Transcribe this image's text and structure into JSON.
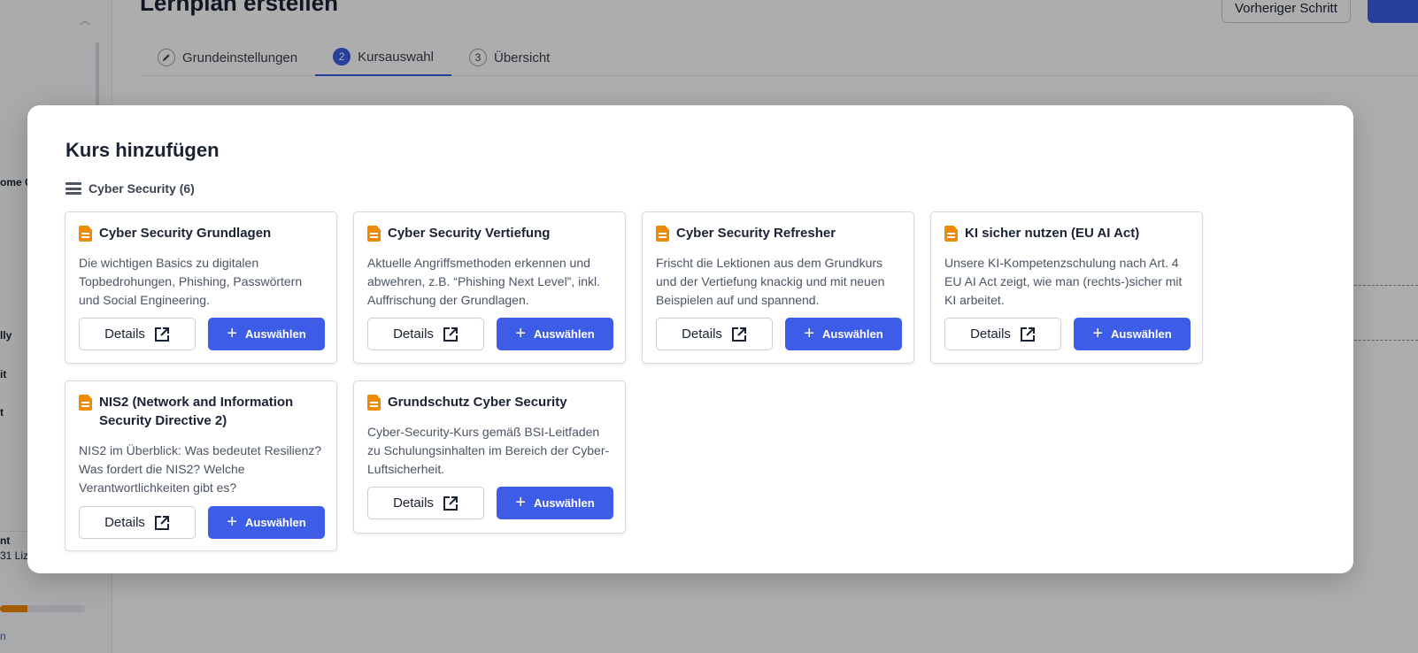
{
  "page": {
    "title": "Lernplan erstellen",
    "prev_button": "Vorheriger Schritt",
    "steps": [
      {
        "num": "",
        "label": "Grundeinstellungen"
      },
      {
        "num": "2",
        "label": "Kursauswahl"
      },
      {
        "num": "3",
        "label": "Übersicht"
      }
    ]
  },
  "sidebar": {
    "fragments": [
      "ome C",
      "lly",
      "it",
      "t"
    ],
    "footer_label": "nt",
    "footer_sub": "31 Liz",
    "footer_link": "n",
    "progress_fraction": 0.32
  },
  "modal": {
    "title": "Kurs hinzufügen",
    "category": "Cyber Security (6)",
    "details_label": "Details",
    "select_label": "Auswählen",
    "courses": [
      {
        "title": "Cyber Security Grundlagen",
        "description": "Die wichtigen Basics zu digitalen Topbedrohungen, Phishing, Passwörtern und Social Engineering."
      },
      {
        "title": "Cyber Security Vertiefung",
        "description": "Aktuelle Angriffsmethoden erkennen und abwehren, z.B. “Phishing Next Level”, inkl. Auffrischung der Grundlagen."
      },
      {
        "title": "Cyber Security Refresher",
        "description": "Frischt die Lektionen aus dem Grundkurs und der Vertiefung knackig und mit neuen Beispielen auf und spannend."
      },
      {
        "title": "KI sicher nutzen (EU AI Act)",
        "description": "Unsere KI-Kompetenzschulung nach Art. 4 EU AI Act zeigt, wie man (rechts-)sicher mit KI arbeitet."
      },
      {
        "title": "NIS2 (Network and Information Security Directive 2)",
        "description": "NIS2 im Überblick: Was bedeutet Resilienz? Was fordert die NIS2? Welche Verantwortlichkeiten gibt es?"
      },
      {
        "title": "Grundschutz Cyber Security",
        "description": "Cyber-Security-Kurs gemäß BSI-Leitfaden zu Schulungsinhalten im Bereich der Cyber-Luftsicherheit."
      }
    ]
  },
  "colors": {
    "accent": "#3d5de8",
    "doc_icon": "#f08a00"
  }
}
